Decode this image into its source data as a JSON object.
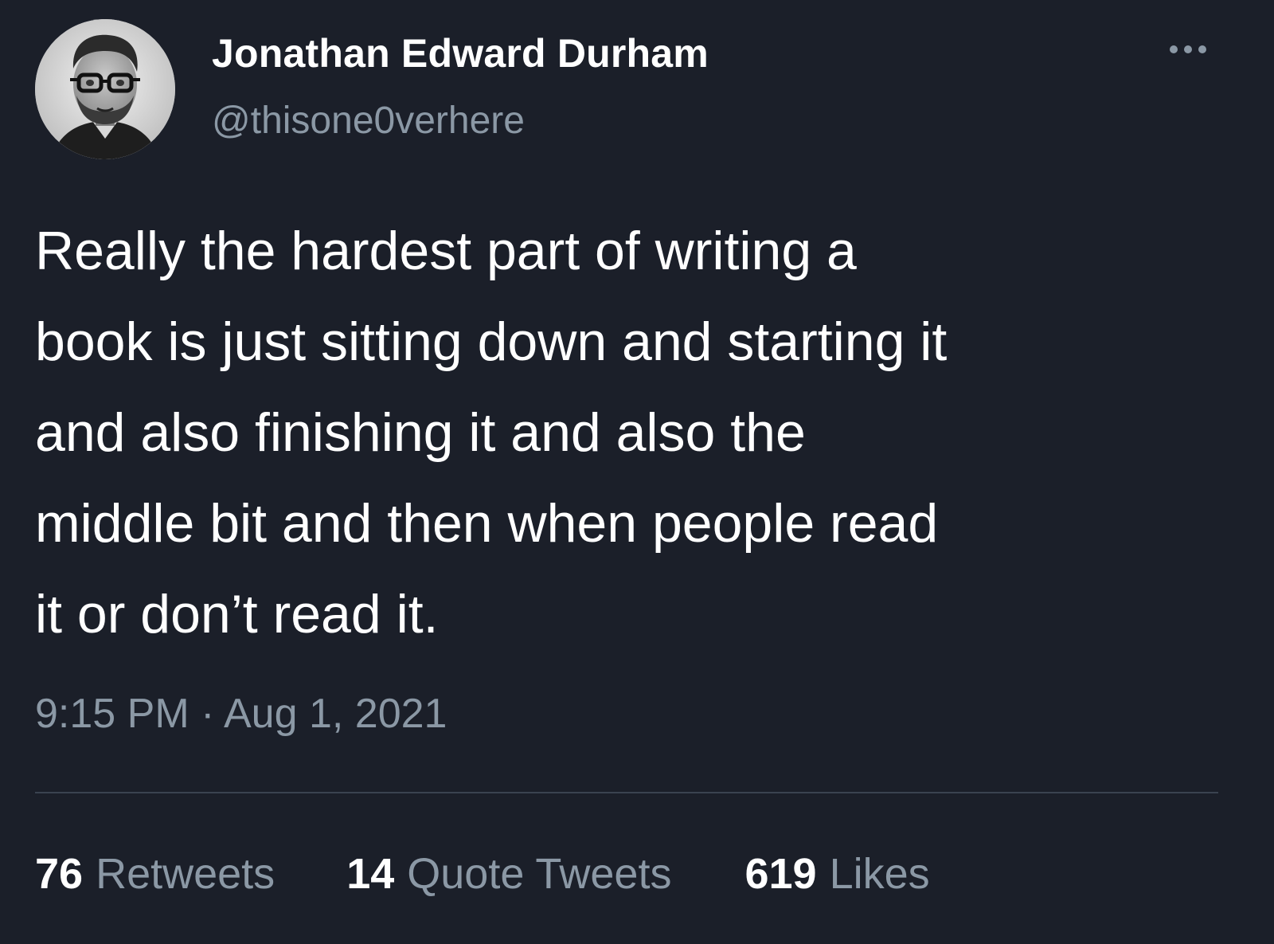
{
  "author": {
    "display_name": "Jonathan Edward Durham",
    "handle": "@thisone0verhere",
    "avatar_icon": "profile-photo"
  },
  "more_icon": "ellipsis-icon",
  "tweet": {
    "lines": [
      "Really the hardest part of writing a",
      "book is just sitting down and starting it",
      "and also finishing it and also the",
      "middle bit and then when people read",
      "it or don’t read it."
    ],
    "timestamp": "9:15 PM · Aug 1, 2021"
  },
  "stats": {
    "retweets": {
      "count": "76",
      "label": "Retweets"
    },
    "quote_tweets": {
      "count": "14",
      "label": "Quote Tweets"
    },
    "likes": {
      "count": "619",
      "label": "Likes"
    }
  },
  "colors": {
    "background": "#1b1f29",
    "text_primary": "#ffffff",
    "text_secondary": "#8b98a5",
    "divider": "#3a4350"
  }
}
